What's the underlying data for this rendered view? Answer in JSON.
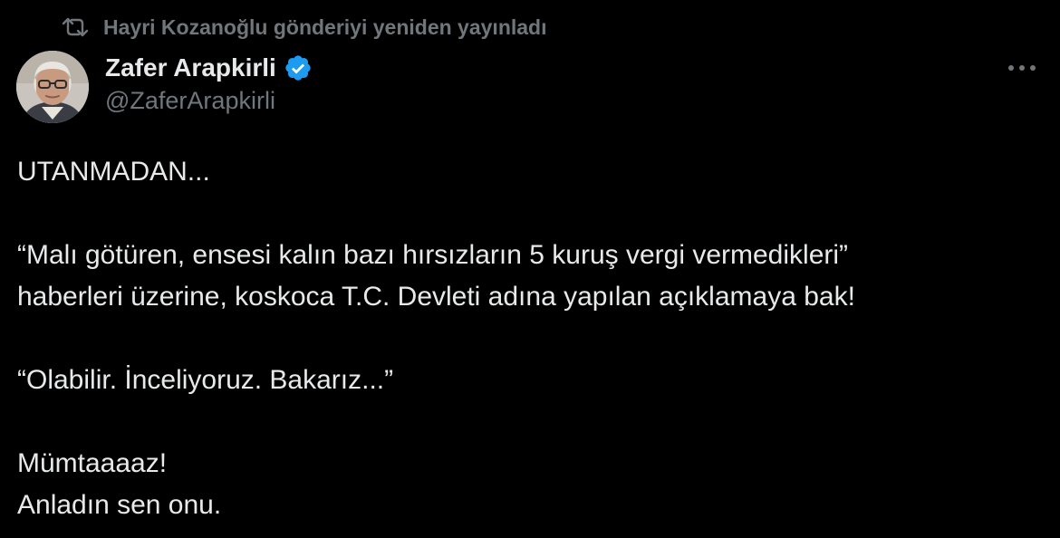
{
  "repost": {
    "text": "Hayri Kozanoğlu gönderiyi yeniden yayınladı",
    "icon": "repost-icon"
  },
  "author": {
    "display_name": "Zafer Arapkirli",
    "handle": "@ZaferArapkirli",
    "verified": true,
    "verified_color": "#1d9bf0"
  },
  "menu": {
    "icon": "more-horizontal-icon"
  },
  "tweet": {
    "line1": "UTANMADAN...",
    "line2": "“Malı götüren, ensesi kalın bazı hırsızların 5 kuruş vergi vermedikleri”",
    "line3": "haberleri üzerine, koskoca T.C. Devleti adına yapılan açıklamaya bak!",
    "line4": "“Olabilir. İnceliyoruz. Bakarız...”",
    "line5": "Mümtaaaaz!",
    "line6": "Anladın sen onu."
  },
  "colors": {
    "background": "#000000",
    "primary_text": "#e7e9ea",
    "secondary_text": "#71767b",
    "accent": "#1d9bf0"
  }
}
